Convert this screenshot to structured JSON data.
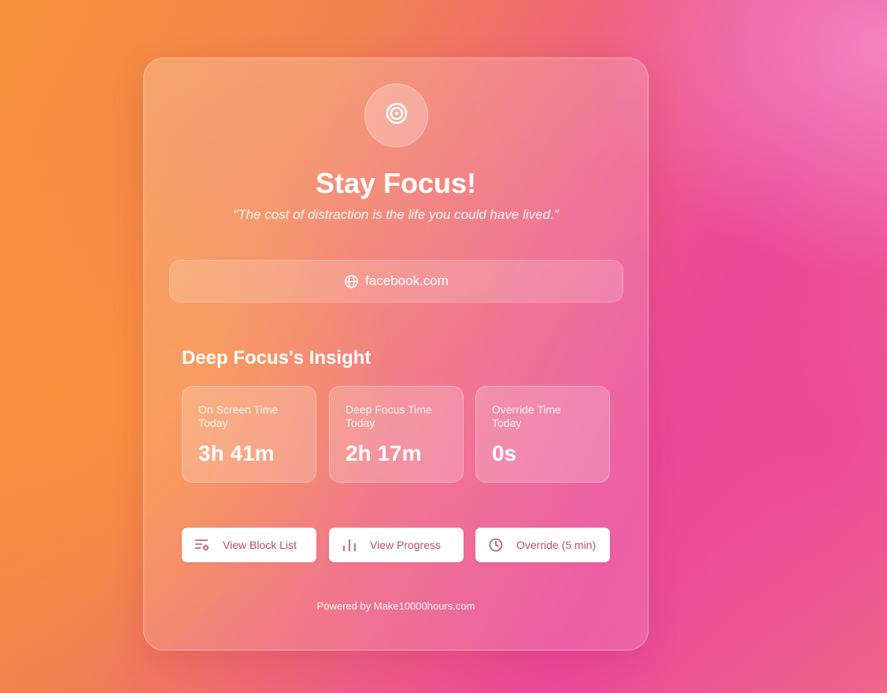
{
  "header": {
    "logo_icon": "target-icon",
    "title": "Stay Focus!",
    "quote": "\"The cost of distraction is the life you could have lived.\""
  },
  "blocked_site": {
    "icon": "globe-icon",
    "domain": "facebook.com"
  },
  "insight": {
    "title": "Deep Focus's Insight",
    "stats": [
      {
        "label": "On Screen Time Today",
        "value": "3h 41m"
      },
      {
        "label": "Deep Focus Time Today",
        "value": "2h 17m"
      },
      {
        "label": "Override Time Today",
        "value": "0s"
      }
    ]
  },
  "actions": [
    {
      "label": "View Block List",
      "icon": "list-settings-icon"
    },
    {
      "label": "View Progress",
      "icon": "bar-chart-icon"
    },
    {
      "label": "Override (5 min)",
      "icon": "clock-icon"
    }
  ],
  "footer": {
    "text": "Powered by Make10000hours.com"
  },
  "colors": {
    "accent_text": "#b5525a",
    "gradient_orange": "#f7933a",
    "gradient_pink": "#ea4899"
  }
}
